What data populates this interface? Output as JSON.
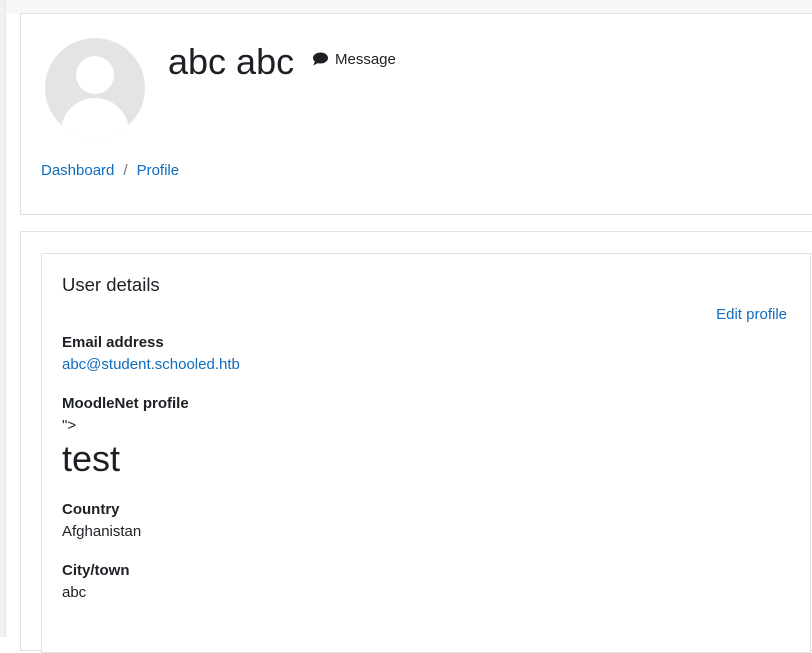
{
  "header": {
    "fullname": "abc abc",
    "message_label": "Message",
    "breadcrumb": [
      {
        "label": "Dashboard"
      },
      {
        "label": "Profile"
      }
    ],
    "breadcrumb_separator": "/"
  },
  "details": {
    "title": "User details",
    "edit_label": "Edit profile",
    "email_label": "Email address",
    "email_value": "abc@student.schooled.htb",
    "moodlenet_label": "MoodleNet profile",
    "moodlenet_value": "\">",
    "moodlenet_heading": "test",
    "country_label": "Country",
    "country_value": "Afghanistan",
    "city_label": "City/town",
    "city_value": "abc"
  },
  "colors": {
    "link": "#0f6cbf",
    "text": "#1d2125",
    "border": "#dee2e6",
    "avatar_bg": "#e4e4e4"
  },
  "icons": {
    "message": "speech-bubble-icon",
    "avatar": "default-user-avatar"
  }
}
